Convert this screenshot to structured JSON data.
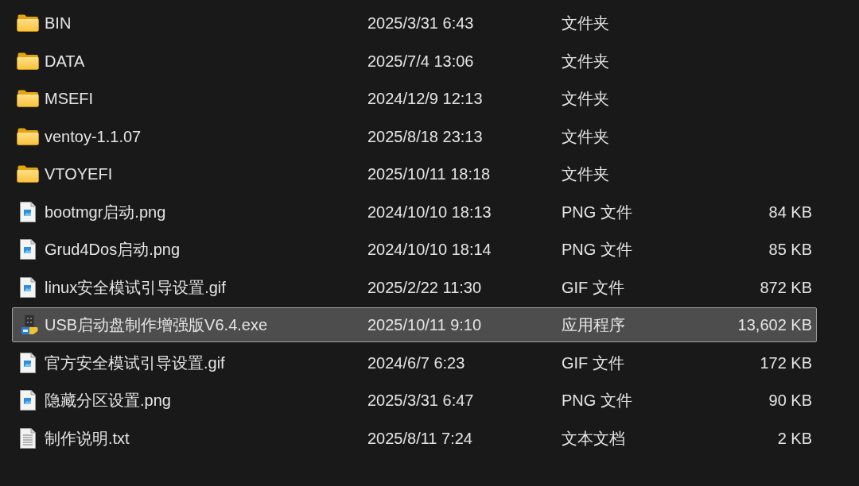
{
  "files": [
    {
      "kind": "folder",
      "name": "BIN",
      "date": "2025/3/31 6:43",
      "type": "文件夹",
      "selected": false
    },
    {
      "kind": "folder",
      "name": "DATA",
      "date": "2025/7/4 13:06",
      "type": "文件夹",
      "selected": false
    },
    {
      "kind": "folder",
      "name": "MSEFI",
      "date": "2024/12/9 12:13",
      "type": "文件夹",
      "selected": false
    },
    {
      "kind": "folder",
      "name": "ventoy-1.1.07",
      "date": "2025/8/18 23:13",
      "type": "文件夹",
      "selected": false
    },
    {
      "kind": "folder",
      "name": "VTOYEFI",
      "date": "2025/10/11 18:18",
      "type": "文件夹",
      "selected": false
    },
    {
      "kind": "image",
      "name": "bootmgr启动.png",
      "date": "2024/10/10 18:13",
      "type": "PNG 文件",
      "size": "84 KB",
      "selected": false
    },
    {
      "kind": "image",
      "name": "Grud4Dos启动.png",
      "date": "2024/10/10 18:14",
      "type": "PNG 文件",
      "size": "85 KB",
      "selected": false
    },
    {
      "kind": "image",
      "name": "linux安全模试引导设置.gif",
      "date": "2025/2/22 11:30",
      "type": "GIF 文件",
      "size": "872 KB",
      "selected": false
    },
    {
      "kind": "application",
      "name": "USB启动盘制作增强版V6.4.exe",
      "date": "2025/10/11 9:10",
      "type": "应用程序",
      "size": "13,602 KB",
      "selected": true
    },
    {
      "kind": "image",
      "name": "官方安全模试引导设置.gif",
      "date": "2024/6/7 6:23",
      "type": "GIF 文件",
      "size": "172 KB",
      "selected": false
    },
    {
      "kind": "image",
      "name": "隐藏分区设置.png",
      "date": "2025/3/31 6:47",
      "type": "PNG 文件",
      "size": "90 KB",
      "selected": false
    },
    {
      "kind": "text",
      "name": "制作说明.txt",
      "date": "2025/8/11 7:24",
      "type": "文本文档",
      "size": "2 KB",
      "selected": false
    }
  ]
}
